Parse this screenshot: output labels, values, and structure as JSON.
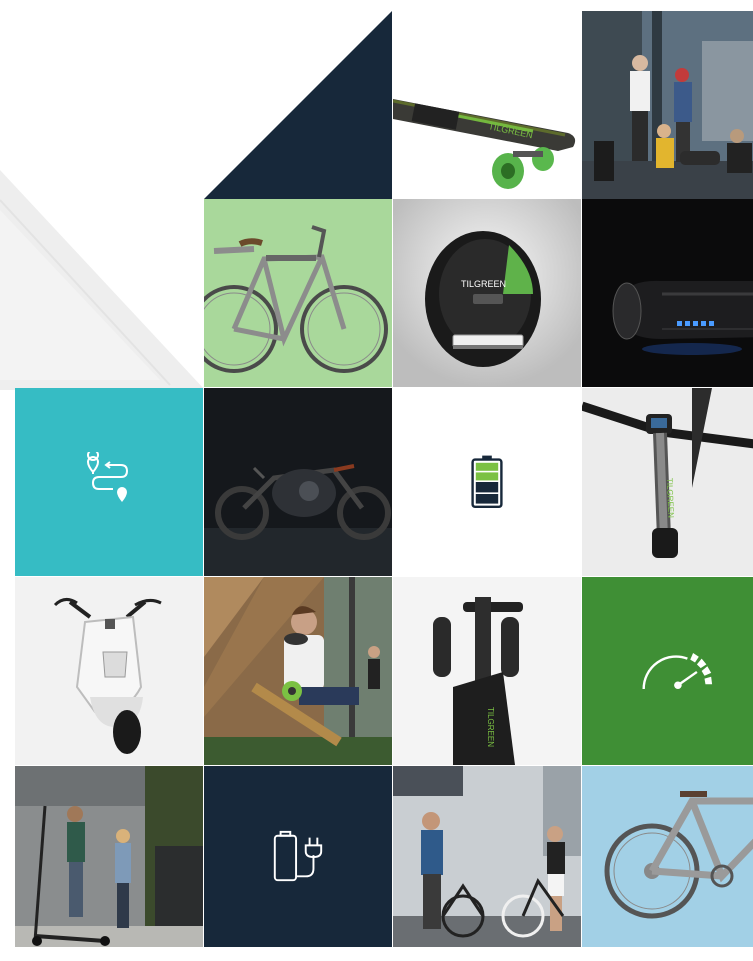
{
  "colors": {
    "navy": "#17283a",
    "teal": "#36bcc4",
    "green": "#3f8f35",
    "light_green": "#a9d89b",
    "light_blue": "#9ecde4",
    "light_gray": "#f2f2f2",
    "white": "#ffffff"
  },
  "brand_text": {
    "board_logo": "TILGREEN",
    "unicycle_logo": "TILGREEN",
    "scooter_logo": "TILGREEN",
    "folded_logo": "TILGREEN"
  },
  "icons": {
    "route": "route-icon",
    "battery": "battery-icon",
    "speed": "speedometer-icon",
    "charger": "charger-icon"
  }
}
